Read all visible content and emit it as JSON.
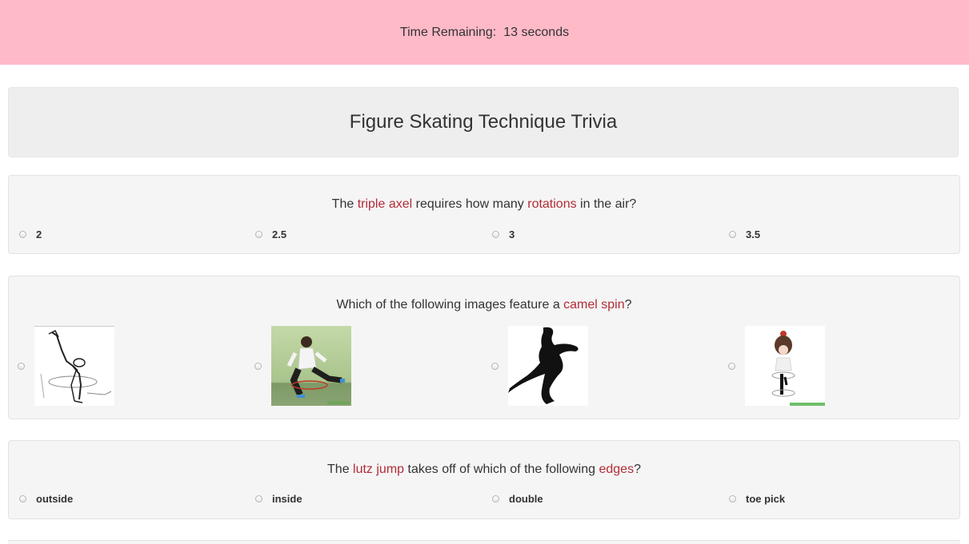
{
  "timer": {
    "label": "Time Remaining:",
    "value": "13 seconds"
  },
  "quiz": {
    "title": "Figure Skating Technique Trivia"
  },
  "questions": [
    {
      "parts": [
        "The ",
        "triple axel",
        " requires how many ",
        "rotations",
        " in the air?"
      ],
      "options": [
        "2",
        "2.5",
        "3",
        "3.5"
      ]
    },
    {
      "parts": [
        "Which of the following images feature a ",
        "camel spin",
        "?"
      ],
      "options": [
        "sketch-skater-spin-image",
        "photo-skater-sit-position-image",
        "silhouette-skater-camel-spin-image",
        "cartoon-skater-upright-spin-image"
      ]
    },
    {
      "parts": [
        "The ",
        "lutz jump",
        " takes off of which of the following ",
        "edges",
        "?"
      ],
      "options": [
        "outside",
        "inside",
        "double",
        "toe pick"
      ]
    }
  ],
  "colors": {
    "timer_bg": "#ffbac8",
    "highlight": "#b22c38",
    "well_bg": "#f5f5f5",
    "title_bg": "#eeeeee"
  }
}
